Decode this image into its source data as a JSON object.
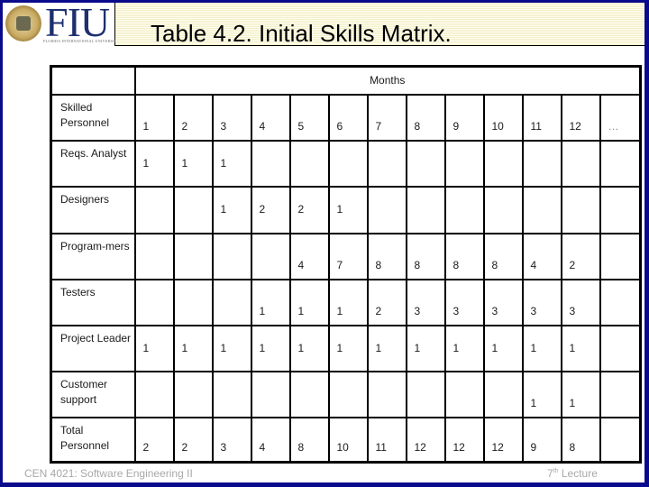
{
  "slide": {
    "title": "Table 4.2. Initial Skills Matrix.",
    "logo": {
      "text": "FIU",
      "subtitle": "FLORIDA INTERNATIONAL UNIVERSITY"
    },
    "footer": {
      "course": "CEN 4021: Software Engineering II",
      "lecture_num": "7",
      "lecture_sup": "th",
      "lecture_word": " Lecture"
    }
  },
  "table": {
    "months_label": "Months",
    "header_row": {
      "label": "Skilled Personnel",
      "cells": [
        "1",
        "2",
        "3",
        "4",
        "5",
        "6",
        "7",
        "8",
        "9",
        "10",
        "11",
        "12",
        "…"
      ]
    },
    "rows": [
      {
        "label": "Reqs. Analyst",
        "cells": [
          "1",
          "1",
          "1",
          "",
          "",
          "",
          "",
          "",
          "",
          "",
          "",
          "",
          ""
        ]
      },
      {
        "label": "Designers",
        "cells": [
          "",
          "",
          "1",
          "2",
          "2",
          "1",
          "",
          "",
          "",
          "",
          "",
          "",
          ""
        ]
      },
      {
        "label": "Program-mers",
        "cells": [
          "",
          "",
          "",
          "",
          "4",
          "7",
          "8",
          "8",
          "8",
          "8",
          "4",
          "2",
          ""
        ]
      },
      {
        "label": "Testers",
        "cells": [
          "",
          "",
          "",
          "1",
          "1",
          "1",
          "2",
          "3",
          "3",
          "3",
          "3",
          "3",
          ""
        ]
      },
      {
        "label": "Project Leader",
        "cells": [
          "1",
          "1",
          "1",
          "1",
          "1",
          "1",
          "1",
          "1",
          "1",
          "1",
          "1",
          "1",
          ""
        ]
      },
      {
        "label": "Customer support",
        "cells": [
          "",
          "",
          "",
          "",
          "",
          "",
          "",
          "",
          "",
          "",
          "1",
          "1",
          ""
        ]
      },
      {
        "label": "Total Personnel",
        "cells": [
          "2",
          "2",
          "3",
          "4",
          "8",
          "10",
          "11",
          "12",
          "12",
          "12",
          "9",
          "8",
          ""
        ]
      }
    ]
  },
  "colors": {
    "frame": "#0a0a8c",
    "title_band": "#f3efc9",
    "logo_blue": "#1d2f6f",
    "footer_text": "#a8a8a8"
  }
}
